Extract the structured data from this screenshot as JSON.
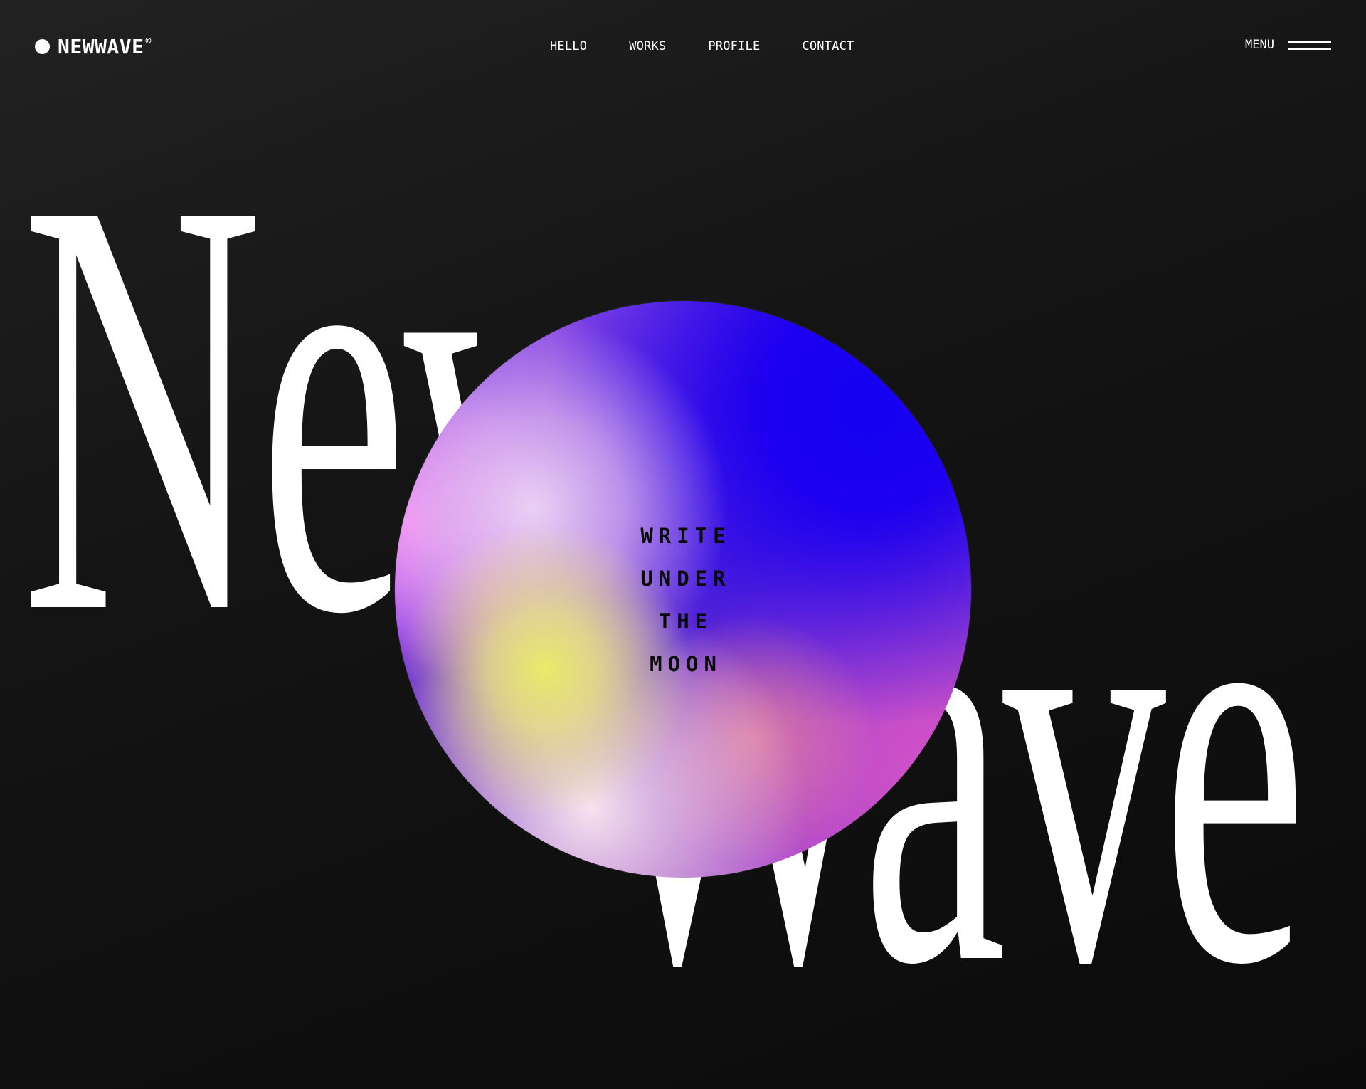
{
  "brand": {
    "name": "NEWWAVE",
    "registered_mark": "®"
  },
  "nav": {
    "items": [
      {
        "label": "HELLO"
      },
      {
        "label": "WORKS"
      },
      {
        "label": "PROFILE"
      },
      {
        "label": "CONTACT"
      }
    ]
  },
  "menu": {
    "label": "MENU",
    "icon": "hamburger-icon"
  },
  "hero": {
    "word_1": "New",
    "word_2": "Wave",
    "orb_lines": [
      "WRITE",
      "UNDER",
      "THE",
      "MOON"
    ]
  },
  "colors": {
    "background": "#141414",
    "text": "#ffffff",
    "orb_blue": "#1500f2",
    "orb_pink": "#ff82f5",
    "orb_yellow": "#eef064",
    "orb_magenta": "#d050c8",
    "orb_text": "#0a0a0a"
  }
}
